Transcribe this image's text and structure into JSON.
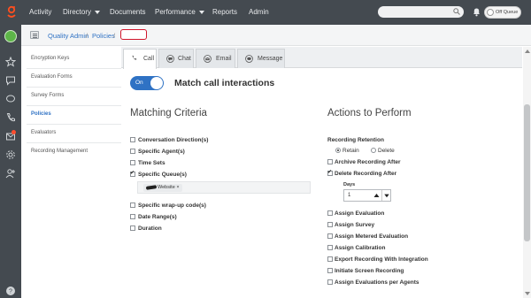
{
  "topnav": {
    "items": [
      {
        "label": "Activity"
      },
      {
        "label": "Directory",
        "has_caret": true
      },
      {
        "label": "Documents"
      },
      {
        "label": "Performance",
        "has_caret": true
      },
      {
        "label": "Reports"
      },
      {
        "label": "Admin"
      }
    ],
    "search_placeholder": "",
    "status_label": "Off Queue"
  },
  "colors": {
    "topbar": "#444a50",
    "accent": "#2f72c4",
    "logo": "#ff4f1f",
    "presence": "#5db548",
    "highlight_outline": "#d1152a"
  },
  "rail_icons": [
    "avatar",
    "star-icon",
    "chat-icon",
    "comment-icon",
    "phone-icon",
    "voicemail-icon",
    "gear-icon",
    "user-add-icon",
    "help-icon"
  ],
  "breadcrumb": {
    "items": [
      "Quality Admin",
      "Policies"
    ],
    "separator": "/",
    "current": ""
  },
  "subnav": {
    "items": [
      "Encryption Keys",
      "Evaluation Forms",
      "Survey Forms",
      "Policies",
      "Evaluators",
      "Recording Management"
    ],
    "active": "Policies"
  },
  "tabs": [
    {
      "label": "Call",
      "icon": "phone-icon",
      "active": true
    },
    {
      "label": "Chat",
      "icon": "chat-icon"
    },
    {
      "label": "Email",
      "icon": "email-icon"
    },
    {
      "label": "Message",
      "icon": "message-icon"
    }
  ],
  "match_toggle": {
    "state_label": "On",
    "on": true,
    "label": "Match call interactions"
  },
  "matching": {
    "heading": "Matching Criteria",
    "criteria": [
      {
        "label": "Conversation Direction(s)",
        "checked": false
      },
      {
        "label": "Specific Agent(s)",
        "checked": false
      },
      {
        "label": "Time Sets",
        "checked": false
      },
      {
        "label": "Specific Queue(s)",
        "checked": true
      },
      {
        "label": "Specific wrap-up code(s)",
        "checked": false
      },
      {
        "label": "Date Range(s)",
        "checked": false
      },
      {
        "label": "Duration",
        "checked": false
      }
    ],
    "queue_chip": {
      "label": "Website",
      "remove": "×"
    }
  },
  "actions": {
    "heading": "Actions to Perform",
    "retention_label": "Recording Retention",
    "retention_options": [
      {
        "label": "Retain",
        "checked": true
      },
      {
        "label": "Delete",
        "checked": false
      }
    ],
    "retention_items": [
      {
        "label": "Archive Recording After",
        "checked": false
      },
      {
        "label": "Delete Recording After",
        "checked": true
      }
    ],
    "days": {
      "label": "Days",
      "value": "1"
    },
    "more_items": [
      {
        "label": "Assign Evaluation",
        "checked": false
      },
      {
        "label": "Assign Survey",
        "checked": false
      },
      {
        "label": "Assign Metered Evaluation",
        "checked": false
      },
      {
        "label": "Assign Calibration",
        "checked": false
      },
      {
        "label": "Export Recording With Integration",
        "checked": false
      },
      {
        "label": "Initiate Screen Recording",
        "checked": false
      },
      {
        "label": "Assign Evaluations per Agents",
        "checked": false
      }
    ]
  }
}
